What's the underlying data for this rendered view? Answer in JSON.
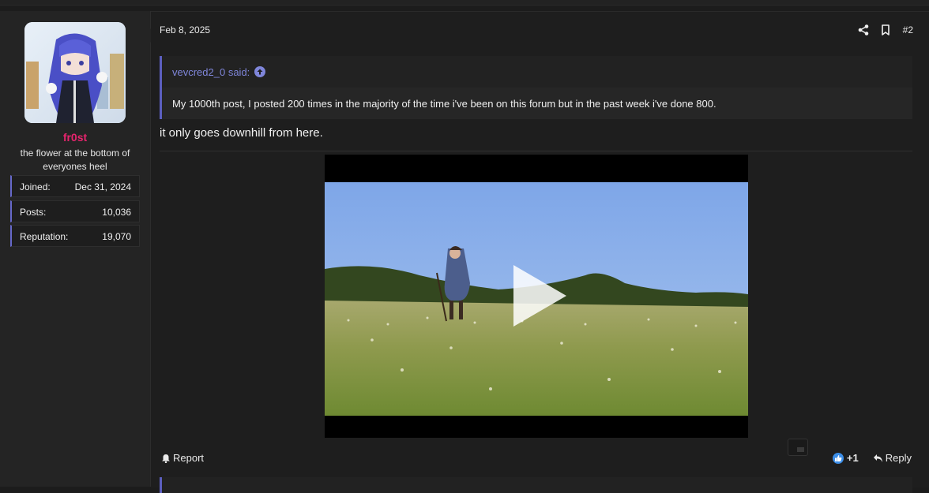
{
  "user": {
    "name": "fr0st",
    "title": "the flower at the bottom of everyones heel",
    "stats": [
      {
        "key": "Joined:",
        "value": "Dec 31, 2024"
      },
      {
        "key": "Posts:",
        "value": "10,036"
      },
      {
        "key": "Reputation:",
        "value": "19,070"
      }
    ]
  },
  "post": {
    "date": "Feb 8, 2025",
    "number": "#2",
    "quote": {
      "author": "vevcred2_0 said:",
      "text": "My 1000th post, I posted 200 times in the majority of the time i've been on this forum but in the past week i've done 800."
    },
    "message": "it only goes downhill from here.",
    "footer": {
      "report_label": "Report",
      "reaction_score": "+1",
      "reply_label": "Reply"
    }
  },
  "icons": {
    "share": "share-icon",
    "bookmark": "bookmark-icon",
    "quote_up": "arrow-up-circle-icon",
    "report": "bell-icon",
    "like": "thumbs-up-icon",
    "reply": "reply-arrow-icon",
    "play": "play-icon"
  },
  "colors": {
    "username": "#e8246e",
    "quote_accent": "#5c5fc0",
    "quote_author": "#7f86da",
    "like": "#3c8ee8"
  }
}
